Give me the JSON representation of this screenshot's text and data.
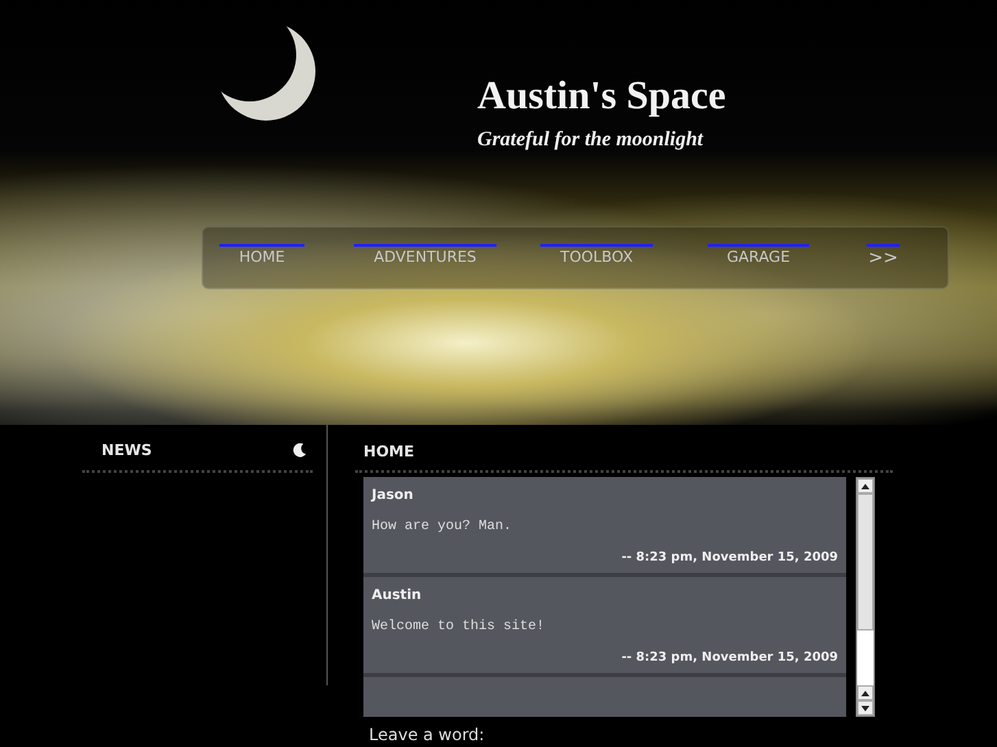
{
  "header": {
    "title": "Austin's Space",
    "subtitle": "Grateful for the moonlight"
  },
  "nav": [
    {
      "label": "HOME"
    },
    {
      "label": "ADVENTURES"
    },
    {
      "label": "TOOLBOX"
    },
    {
      "label": "GARAGE"
    },
    {
      "label": ">>"
    }
  ],
  "sidebar": {
    "heading": "NEWS"
  },
  "main": {
    "heading": "HOME",
    "messages": [
      {
        "author": "Jason",
        "body": "How are you? Man.",
        "time": "-- 8:23 pm, November 15, 2009"
      },
      {
        "author": "Austin",
        "body": "Welcome to this site!",
        "time": "-- 8:23 pm, November 15, 2009"
      }
    ],
    "form_label": "Leave a word:"
  }
}
